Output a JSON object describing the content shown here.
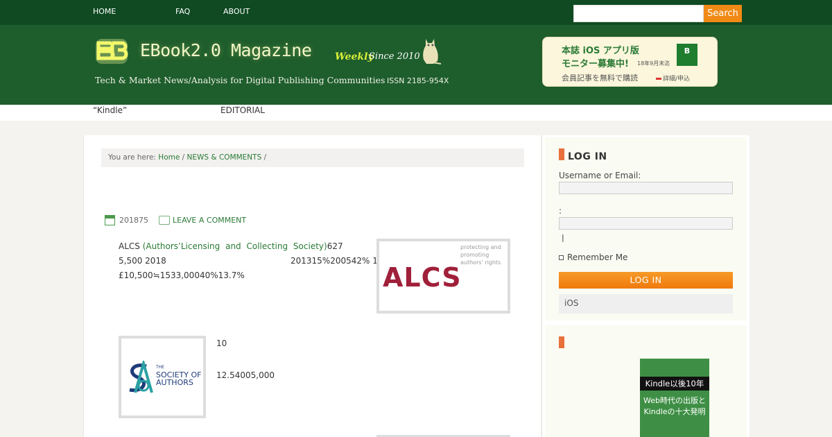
{
  "topnav": {
    "items": [
      {
        "label": "HOME"
      },
      {
        "label": "FAQ"
      },
      {
        "label": "ABOUT"
      }
    ],
    "search_placeholder": "",
    "search_label": "Search"
  },
  "header": {
    "logo_title": "EBook2.0 Magazine",
    "logo_weekly": "Weekly",
    "logo_since": "Since 2010",
    "tagline": "Tech & Market News/Analysis for Digital Publishing Communities",
    "issn": "ISSN 2185-954X",
    "promo": {
      "line1": "本誌 iOS アプリ版",
      "line2": "モニター募集中!",
      "small": "18年9月末迄",
      "line3": "会員記事を無料で購読",
      "link": "詳細/申込"
    }
  },
  "subnav": {
    "items": [
      {
        "label": "“Kindle”"
      },
      {
        "label": "EDITORIAL"
      }
    ]
  },
  "breadcrumb": {
    "prefix": "You are here:",
    "home": "Home",
    "sep1": "/",
    "section": "NEWS & COMMENTS",
    "sep2": "/"
  },
  "post": {
    "date": "201875",
    "comment_link": "LEAVE A COMMENT",
    "p1_prefix": "ALCS",
    "p1_link": "(Authors’Licensing and Collecting Society)",
    "p1_suffix": "627",
    "p1_line2a": "5,500 2018",
    "p1_line2b": "201315%200542% 1",
    "p1_line3": "£10,500≒1533,00040%13.7%",
    "alcs_tagline": "protecting and promoting authors' rights",
    "alcs_word": "ALCS",
    "soa_the": "THE",
    "soa_line1": "SOCIETY OF",
    "soa_line2": "AUTHORS",
    "p2_line1": "10",
    "p2_line2": "12.54005,000"
  },
  "sidebar": {
    "login": {
      "title": "LOG IN",
      "username_label": "Username or Email:",
      "password_label": ":",
      "caret": "|",
      "remember_label": "Remember Me",
      "button_label": "LOG IN",
      "ios_label": "iOS"
    },
    "book": {
      "band": "Kindle以後10年",
      "line1": "Web時代の出版と",
      "line2": "Kindleの十大発明"
    }
  },
  "colors": {
    "topbar": "#0f4a22",
    "header": "#1e5d2c",
    "accent_orange": "#f08a15",
    "link_green": "#2a7a35",
    "alcs_red": "#a0203a"
  }
}
